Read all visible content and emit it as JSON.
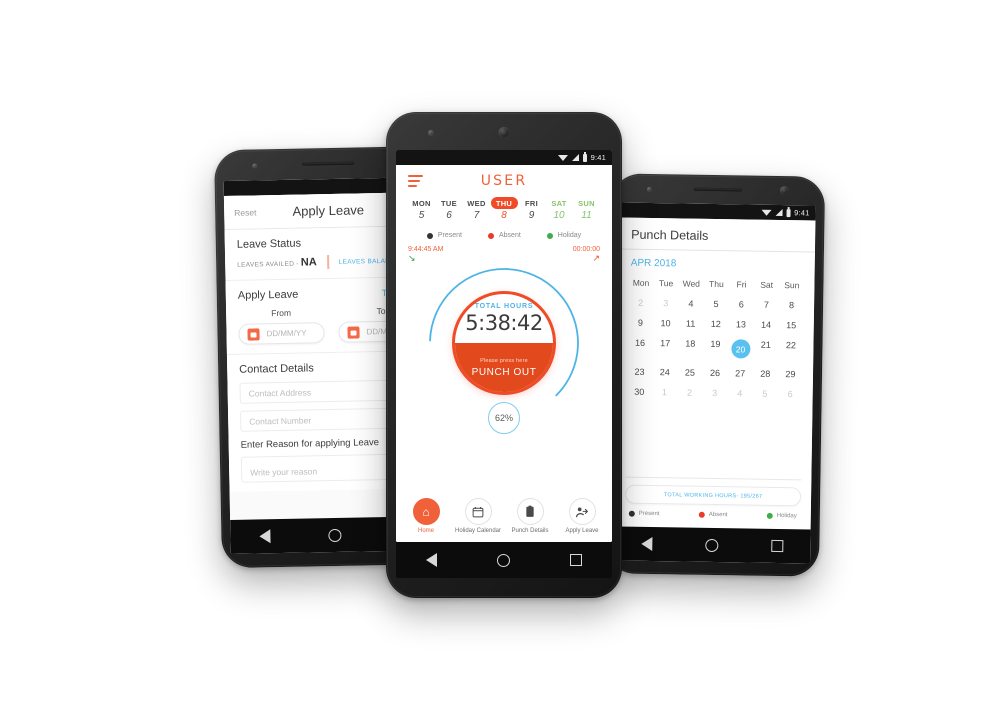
{
  "center_phone": {
    "status_bar": {
      "time": "9:41"
    },
    "header": {
      "menu_icon": "hamburger-icon",
      "title": "USER"
    },
    "week_days": [
      {
        "name": "MON",
        "num": "5",
        "state": "normal"
      },
      {
        "name": "TUE",
        "num": "6",
        "state": "normal"
      },
      {
        "name": "WED",
        "num": "7",
        "state": "normal"
      },
      {
        "name": "THU",
        "num": "8",
        "state": "selected"
      },
      {
        "name": "FRI",
        "num": "9",
        "state": "normal"
      },
      {
        "name": "SAT",
        "num": "10",
        "state": "holiday"
      },
      {
        "name": "SUN",
        "num": "11",
        "state": "holiday"
      }
    ],
    "legend": [
      {
        "label": "Present",
        "color": "#333333"
      },
      {
        "label": "Absent",
        "color": "#e83c28"
      },
      {
        "label": "Holiday",
        "color": "#3fae4a"
      }
    ],
    "punch_in": {
      "time": "9:44:45 AM",
      "arrow": "arrow-down-right-icon"
    },
    "punch_out": {
      "time": "00:00:00",
      "arrow": "arrow-up-right-icon"
    },
    "gauge": {
      "total_hours_label": "TOTAL HOURS",
      "total_hours_value": "5:38:42",
      "press_hint": "Please press here",
      "button_label": "PUNCH OUT",
      "percent": "62%",
      "ring_color": "#4eb4e6",
      "dial_color": "#ef4b28"
    },
    "tabs": [
      {
        "label": "Home",
        "icon": "home-icon",
        "glyph": "⌂",
        "active": true
      },
      {
        "label": "Holiday Calendar",
        "icon": "calendar-icon",
        "glyph": "Ὄ5",
        "active": false
      },
      {
        "label": "Punch Details",
        "icon": "clipboard-icon",
        "glyph": "▯",
        "active": false
      },
      {
        "label": "Apply Leave",
        "icon": "person-leave-icon",
        "glyph": "↱",
        "active": false
      }
    ]
  },
  "left_phone": {
    "status_bar": {
      "time": ""
    },
    "header": {
      "reset_label": "Reset",
      "title": "Apply Leave"
    },
    "leave_status": {
      "section_title": "Leave Status",
      "availed_label": "LEAVES AVAILED -",
      "availed_value": "NA",
      "balance_label": "LEAVES BALANCE"
    },
    "apply_leave": {
      "section_title": "Apply Leave",
      "total_days_label": "Total Days",
      "from_label": "From",
      "from_placeholder": "DD/MM/YY",
      "to_label": "To",
      "to_placeholder": "DD/MM/YY"
    },
    "contact": {
      "section_title": "Contact Details",
      "address_placeholder": "Contact Address",
      "number_placeholder": "Contact Number"
    },
    "reason": {
      "label": "Enter Reason for applying Leave",
      "placeholder": "Write your reason"
    }
  },
  "right_phone": {
    "status_bar": {
      "time": "9:41"
    },
    "header": {
      "title": "Punch Details"
    },
    "month": "APR 2018",
    "calendar": {
      "weekday_headers": [
        "Mon",
        "Tue",
        "Wed",
        "Thu",
        "Fri",
        "Sat",
        "Sun"
      ],
      "weeks": [
        [
          {
            "d": "2",
            "s": "mut"
          },
          {
            "d": "3",
            "s": "mut"
          },
          {
            "d": "4",
            "s": "n"
          },
          {
            "d": "5",
            "s": "n"
          },
          {
            "d": "6",
            "s": "n"
          },
          {
            "d": "7",
            "s": "n"
          },
          {
            "d": "8",
            "s": "n"
          }
        ],
        [
          {
            "d": "9",
            "s": "n"
          },
          {
            "d": "10",
            "s": "n"
          },
          {
            "d": "11",
            "s": "n"
          },
          {
            "d": "12",
            "s": "n"
          },
          {
            "d": "13",
            "s": "n"
          },
          {
            "d": "14",
            "s": "n"
          },
          {
            "d": "15",
            "s": "n"
          }
        ],
        [
          {
            "d": "16",
            "s": "n"
          },
          {
            "d": "17",
            "s": "n"
          },
          {
            "d": "18",
            "s": "n"
          },
          {
            "d": "19",
            "s": "n"
          },
          {
            "d": "20",
            "s": "today"
          },
          {
            "d": "21",
            "s": "n"
          },
          {
            "d": "22",
            "s": "n"
          }
        ],
        [
          {
            "d": "23",
            "s": "n"
          },
          {
            "d": "24",
            "s": "n"
          },
          {
            "d": "25",
            "s": "n"
          },
          {
            "d": "26",
            "s": "n"
          },
          {
            "d": "27",
            "s": "n"
          },
          {
            "d": "28",
            "s": "n"
          },
          {
            "d": "29",
            "s": "n"
          }
        ],
        [
          {
            "d": "30",
            "s": "n"
          },
          {
            "d": "1",
            "s": "mut"
          },
          {
            "d": "2",
            "s": "mut"
          },
          {
            "d": "3",
            "s": "mut"
          },
          {
            "d": "4",
            "s": "mut"
          },
          {
            "d": "5",
            "s": "mut"
          },
          {
            "d": "6",
            "s": "mut"
          }
        ]
      ]
    },
    "total_working_hours": "TOTAL WORKING HOURS- 195/267",
    "legend": [
      {
        "label": "Present",
        "color": "#333333"
      },
      {
        "label": "Absent",
        "color": "#e83c28"
      },
      {
        "label": "Holiday",
        "color": "#3fae4a"
      }
    ]
  }
}
